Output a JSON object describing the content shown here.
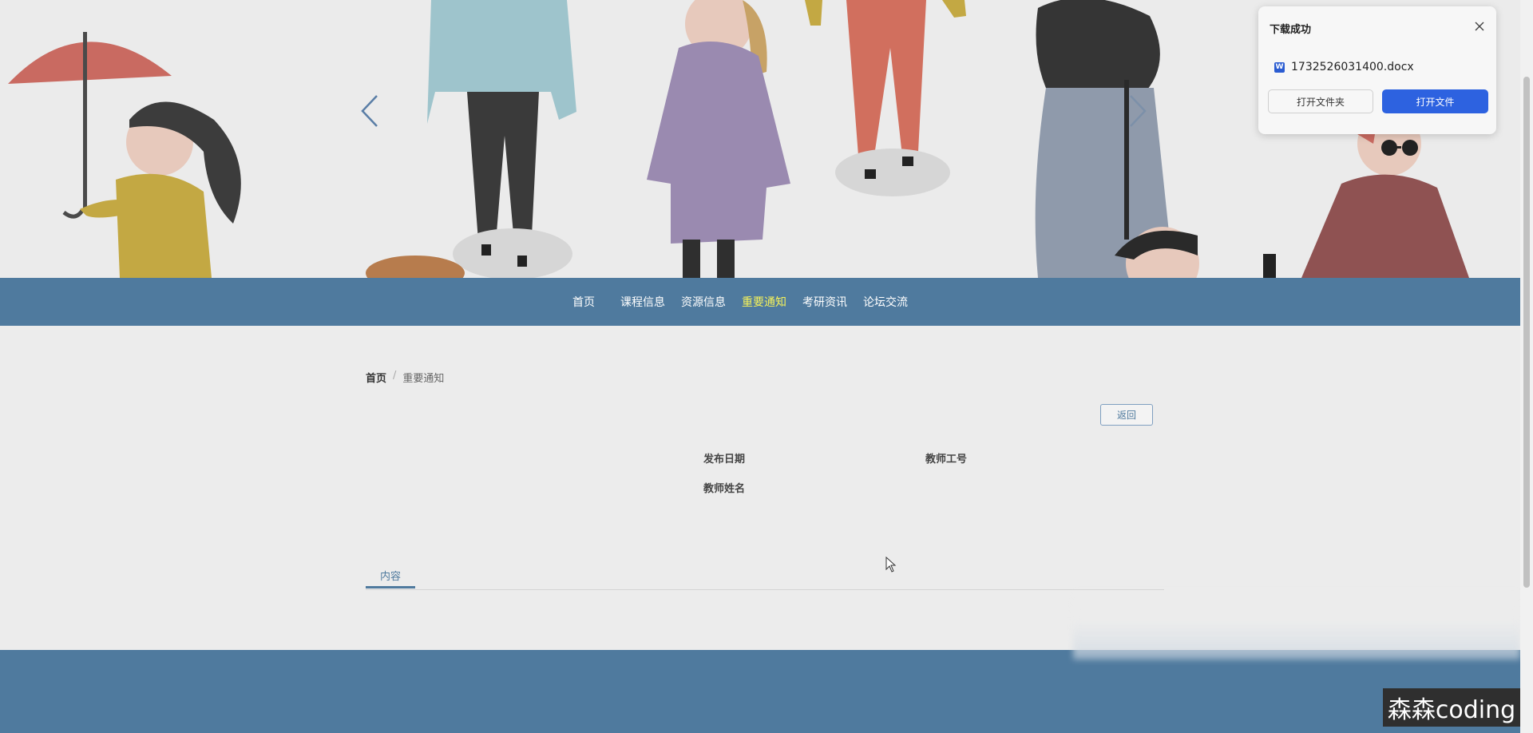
{
  "nav": {
    "items": [
      {
        "label": "首页"
      },
      {
        "label": "课程信息"
      },
      {
        "label": "资源信息"
      },
      {
        "label": "重要通知"
      },
      {
        "label": "考研资讯"
      },
      {
        "label": "论坛交流"
      }
    ],
    "active_index": 3
  },
  "breadcrumb": {
    "home": "首页",
    "separator": "/",
    "current": "重要通知"
  },
  "detail": {
    "back_label": "返回",
    "publish_date_label": "发布日期",
    "teacher_id_label": "教师工号",
    "teacher_name_label": "教师姓名",
    "tab_label": "内容"
  },
  "download_popup": {
    "title": "下载成功",
    "file_name": "1732526031400.docx",
    "file_icon_letter": "W",
    "open_folder_label": "打开文件夹",
    "open_file_label": "打开文件"
  },
  "watermark": "森森coding",
  "colors": {
    "nav_bg": "#4f7a9e",
    "nav_active": "#f6f25a",
    "primary_button": "#2d62e0",
    "page_bg": "#ececec"
  },
  "icons": [
    "chevron-left-icon",
    "chevron-right-icon",
    "close-icon",
    "word-file-icon",
    "mouse-cursor-icon"
  ]
}
